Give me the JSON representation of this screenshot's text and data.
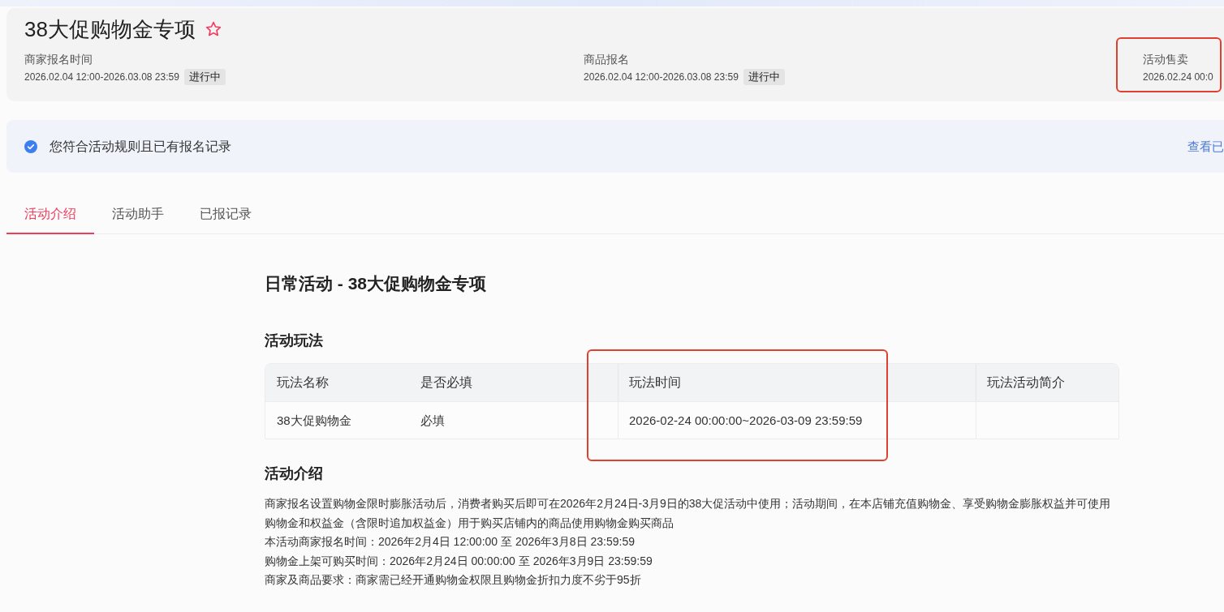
{
  "header": {
    "title": "38大促购物金专项",
    "starred": false,
    "items": [
      {
        "label": "商家报名时间",
        "value": "2026.02.04 12:00-2026.03.08 23:59",
        "status": "进行中",
        "highlighted": false
      },
      {
        "label": "商品报名",
        "value": "2026.02.04 12:00-2026.03.08 23:59",
        "status": "进行中",
        "highlighted": false
      },
      {
        "label": "活动售卖",
        "value": "2026.02.24 00:0",
        "highlighted": true
      }
    ]
  },
  "notice": {
    "text": "您符合活动规则且已有报名记录",
    "link": "查看已"
  },
  "tabs": [
    {
      "label": "活动介绍",
      "selected": true
    },
    {
      "label": "活动助手",
      "selected": false
    },
    {
      "label": "已报记录",
      "selected": false
    }
  ],
  "content": {
    "title": "日常活动 - 38大促购物金专项",
    "gameplay": {
      "heading": "活动玩法",
      "columns": [
        {
          "label": "玩法名称",
          "highlighted": false
        },
        {
          "label": "是否必填",
          "highlighted": false
        },
        {
          "label": "玩法时间",
          "highlighted": true
        },
        {
          "label": "玩法活动简介",
          "highlighted": false
        }
      ],
      "rows": [
        {
          "cells": [
            "38大促购物金",
            "必填",
            "2026-02-24 00:00:00~2026-03-09 23:59:59"
          ]
        }
      ]
    },
    "intro": {
      "heading": "活动介绍",
      "paragraphs": [
        "商家报名设置购物金限时膨胀活动后，消费者购买后即可在2026年2月24日-3月9日的38大促活动中使用；活动期间，在本店铺充值购物金、享受购物金膨胀权益并可使用购物金和权益金（含限时追加权益金）用于购买店铺内的商品使用购物金购买商品",
        "本活动商家报名时间：2026年2月4日 12:00:00 至 2026年3月8日 23:59:59",
        "购物金上架可购买时间：2026年2月24日 00:00:00 至 2026年3月9日 23:59:59",
        "商家及商品要求：商家需已经开通购物金权限且购物金折扣力度不劣于95折"
      ]
    }
  }
}
